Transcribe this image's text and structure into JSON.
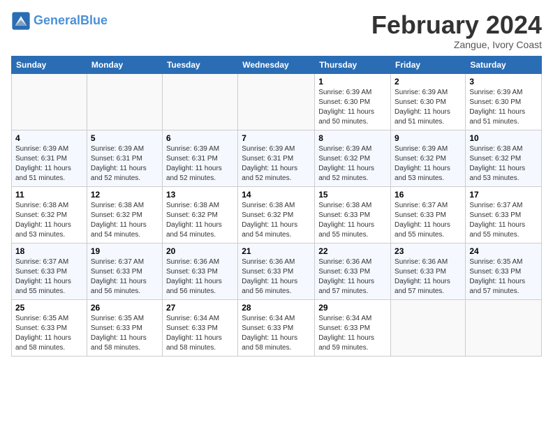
{
  "logo": {
    "text_general": "General",
    "text_blue": "Blue"
  },
  "title": "February 2024",
  "subtitle": "Zangue, Ivory Coast",
  "days_of_week": [
    "Sunday",
    "Monday",
    "Tuesday",
    "Wednesday",
    "Thursday",
    "Friday",
    "Saturday"
  ],
  "weeks": [
    [
      {
        "num": "",
        "sunrise": "",
        "sunset": "",
        "daylight": "",
        "empty": true
      },
      {
        "num": "",
        "sunrise": "",
        "sunset": "",
        "daylight": "",
        "empty": true
      },
      {
        "num": "",
        "sunrise": "",
        "sunset": "",
        "daylight": "",
        "empty": true
      },
      {
        "num": "",
        "sunrise": "",
        "sunset": "",
        "daylight": "",
        "empty": true
      },
      {
        "num": "1",
        "sunrise": "Sunrise: 6:39 AM",
        "sunset": "Sunset: 6:30 PM",
        "daylight": "Daylight: 11 hours and 50 minutes."
      },
      {
        "num": "2",
        "sunrise": "Sunrise: 6:39 AM",
        "sunset": "Sunset: 6:30 PM",
        "daylight": "Daylight: 11 hours and 51 minutes."
      },
      {
        "num": "3",
        "sunrise": "Sunrise: 6:39 AM",
        "sunset": "Sunset: 6:30 PM",
        "daylight": "Daylight: 11 hours and 51 minutes."
      }
    ],
    [
      {
        "num": "4",
        "sunrise": "Sunrise: 6:39 AM",
        "sunset": "Sunset: 6:31 PM",
        "daylight": "Daylight: 11 hours and 51 minutes."
      },
      {
        "num": "5",
        "sunrise": "Sunrise: 6:39 AM",
        "sunset": "Sunset: 6:31 PM",
        "daylight": "Daylight: 11 hours and 52 minutes."
      },
      {
        "num": "6",
        "sunrise": "Sunrise: 6:39 AM",
        "sunset": "Sunset: 6:31 PM",
        "daylight": "Daylight: 11 hours and 52 minutes."
      },
      {
        "num": "7",
        "sunrise": "Sunrise: 6:39 AM",
        "sunset": "Sunset: 6:31 PM",
        "daylight": "Daylight: 11 hours and 52 minutes."
      },
      {
        "num": "8",
        "sunrise": "Sunrise: 6:39 AM",
        "sunset": "Sunset: 6:32 PM",
        "daylight": "Daylight: 11 hours and 52 minutes."
      },
      {
        "num": "9",
        "sunrise": "Sunrise: 6:39 AM",
        "sunset": "Sunset: 6:32 PM",
        "daylight": "Daylight: 11 hours and 53 minutes."
      },
      {
        "num": "10",
        "sunrise": "Sunrise: 6:38 AM",
        "sunset": "Sunset: 6:32 PM",
        "daylight": "Daylight: 11 hours and 53 minutes."
      }
    ],
    [
      {
        "num": "11",
        "sunrise": "Sunrise: 6:38 AM",
        "sunset": "Sunset: 6:32 PM",
        "daylight": "Daylight: 11 hours and 53 minutes."
      },
      {
        "num": "12",
        "sunrise": "Sunrise: 6:38 AM",
        "sunset": "Sunset: 6:32 PM",
        "daylight": "Daylight: 11 hours and 54 minutes."
      },
      {
        "num": "13",
        "sunrise": "Sunrise: 6:38 AM",
        "sunset": "Sunset: 6:32 PM",
        "daylight": "Daylight: 11 hours and 54 minutes."
      },
      {
        "num": "14",
        "sunrise": "Sunrise: 6:38 AM",
        "sunset": "Sunset: 6:32 PM",
        "daylight": "Daylight: 11 hours and 54 minutes."
      },
      {
        "num": "15",
        "sunrise": "Sunrise: 6:38 AM",
        "sunset": "Sunset: 6:33 PM",
        "daylight": "Daylight: 11 hours and 55 minutes."
      },
      {
        "num": "16",
        "sunrise": "Sunrise: 6:37 AM",
        "sunset": "Sunset: 6:33 PM",
        "daylight": "Daylight: 11 hours and 55 minutes."
      },
      {
        "num": "17",
        "sunrise": "Sunrise: 6:37 AM",
        "sunset": "Sunset: 6:33 PM",
        "daylight": "Daylight: 11 hours and 55 minutes."
      }
    ],
    [
      {
        "num": "18",
        "sunrise": "Sunrise: 6:37 AM",
        "sunset": "Sunset: 6:33 PM",
        "daylight": "Daylight: 11 hours and 55 minutes."
      },
      {
        "num": "19",
        "sunrise": "Sunrise: 6:37 AM",
        "sunset": "Sunset: 6:33 PM",
        "daylight": "Daylight: 11 hours and 56 minutes."
      },
      {
        "num": "20",
        "sunrise": "Sunrise: 6:36 AM",
        "sunset": "Sunset: 6:33 PM",
        "daylight": "Daylight: 11 hours and 56 minutes."
      },
      {
        "num": "21",
        "sunrise": "Sunrise: 6:36 AM",
        "sunset": "Sunset: 6:33 PM",
        "daylight": "Daylight: 11 hours and 56 minutes."
      },
      {
        "num": "22",
        "sunrise": "Sunrise: 6:36 AM",
        "sunset": "Sunset: 6:33 PM",
        "daylight": "Daylight: 11 hours and 57 minutes."
      },
      {
        "num": "23",
        "sunrise": "Sunrise: 6:36 AM",
        "sunset": "Sunset: 6:33 PM",
        "daylight": "Daylight: 11 hours and 57 minutes."
      },
      {
        "num": "24",
        "sunrise": "Sunrise: 6:35 AM",
        "sunset": "Sunset: 6:33 PM",
        "daylight": "Daylight: 11 hours and 57 minutes."
      }
    ],
    [
      {
        "num": "25",
        "sunrise": "Sunrise: 6:35 AM",
        "sunset": "Sunset: 6:33 PM",
        "daylight": "Daylight: 11 hours and 58 minutes."
      },
      {
        "num": "26",
        "sunrise": "Sunrise: 6:35 AM",
        "sunset": "Sunset: 6:33 PM",
        "daylight": "Daylight: 11 hours and 58 minutes."
      },
      {
        "num": "27",
        "sunrise": "Sunrise: 6:34 AM",
        "sunset": "Sunset: 6:33 PM",
        "daylight": "Daylight: 11 hours and 58 minutes."
      },
      {
        "num": "28",
        "sunrise": "Sunrise: 6:34 AM",
        "sunset": "Sunset: 6:33 PM",
        "daylight": "Daylight: 11 hours and 58 minutes."
      },
      {
        "num": "29",
        "sunrise": "Sunrise: 6:34 AM",
        "sunset": "Sunset: 6:33 PM",
        "daylight": "Daylight: 11 hours and 59 minutes."
      },
      {
        "num": "",
        "sunrise": "",
        "sunset": "",
        "daylight": "",
        "empty": true
      },
      {
        "num": "",
        "sunrise": "",
        "sunset": "",
        "daylight": "",
        "empty": true
      }
    ]
  ]
}
